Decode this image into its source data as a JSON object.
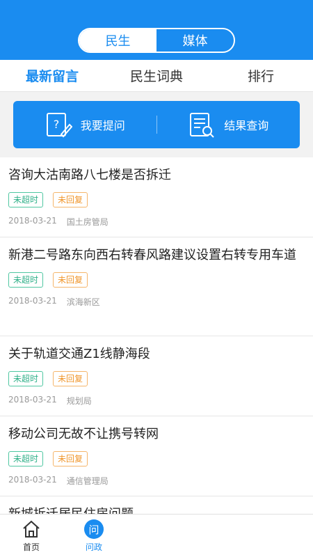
{
  "header": {
    "segments": [
      {
        "label": "民生"
      },
      {
        "label": "媒体"
      }
    ]
  },
  "tabs": [
    {
      "label": "最新留言"
    },
    {
      "label": "民生词典"
    },
    {
      "label": "排行"
    }
  ],
  "actions": {
    "ask_label": "我要提问",
    "query_label": "结果查询"
  },
  "list": [
    {
      "title": "咨询大沽南路八七楼是否拆迁",
      "tag1": "未超时",
      "tag2": "未回复",
      "date": "2018-03-21",
      "org": "国土房管局"
    },
    {
      "title": "新港二号路东向西右转春风路建议设置右转专用车道",
      "tag1": "未超时",
      "tag2": "未回复",
      "date": "2018-03-21",
      "org": "滨海新区"
    },
    {
      "title": "关于轨道交通Z1线静海段",
      "tag1": "未超时",
      "tag2": "未回复",
      "date": "2018-03-21",
      "org": "规划局"
    },
    {
      "title": "移动公司无故不让携号转网",
      "tag1": "未超时",
      "tag2": "未回复",
      "date": "2018-03-21",
      "org": "通信管理局"
    },
    {
      "title": "新城拆迁居民住房问题",
      "tag1": "",
      "tag2": "",
      "date": "",
      "org": ""
    }
  ],
  "tabbar": {
    "home_label": "首页",
    "wenzheng_label": "问政",
    "wenzheng_icon_char": "问",
    "item3_label": "",
    "item4_label": "",
    "item5_label": ""
  },
  "colors": {
    "primary": "#1a8cf0",
    "tag_green": "#2fb088",
    "tag_orange": "#f0962b"
  }
}
